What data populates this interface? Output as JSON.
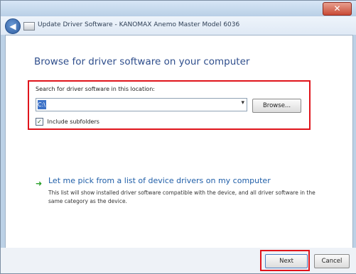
{
  "window": {
    "close_glyph": "✕",
    "nav_title": "Update Driver Software - KANOMAX Anemo Master Model 6036"
  },
  "nav": {
    "back_glyph": "◀"
  },
  "main": {
    "heading": "Browse for driver software on your computer",
    "search_label": "Search for driver software in this location:",
    "path_value": "C:\\",
    "combo_arrow": "▾",
    "browse_label": "Browse...",
    "include_subfolders_label": "Include subfolders",
    "include_subfolders_checked": true,
    "checkbox_glyph": "✓",
    "pick_arrow_glyph": "➜",
    "pick_link": "Let me pick from a list of device drivers on my computer",
    "pick_description": "This list will show installed driver software compatible with the device, and all driver software in the same category as the device."
  },
  "footer": {
    "next_label": "Next",
    "cancel_label": "Cancel"
  },
  "colors": {
    "highlight_border": "#e0141b",
    "link": "#1f5ea8",
    "heading": "#2f4e8c"
  },
  "icons": {
    "back": "back-arrow-icon",
    "wizard": "wizard-window-icon",
    "pick": "green-arrow-icon",
    "close": "close-icon"
  }
}
